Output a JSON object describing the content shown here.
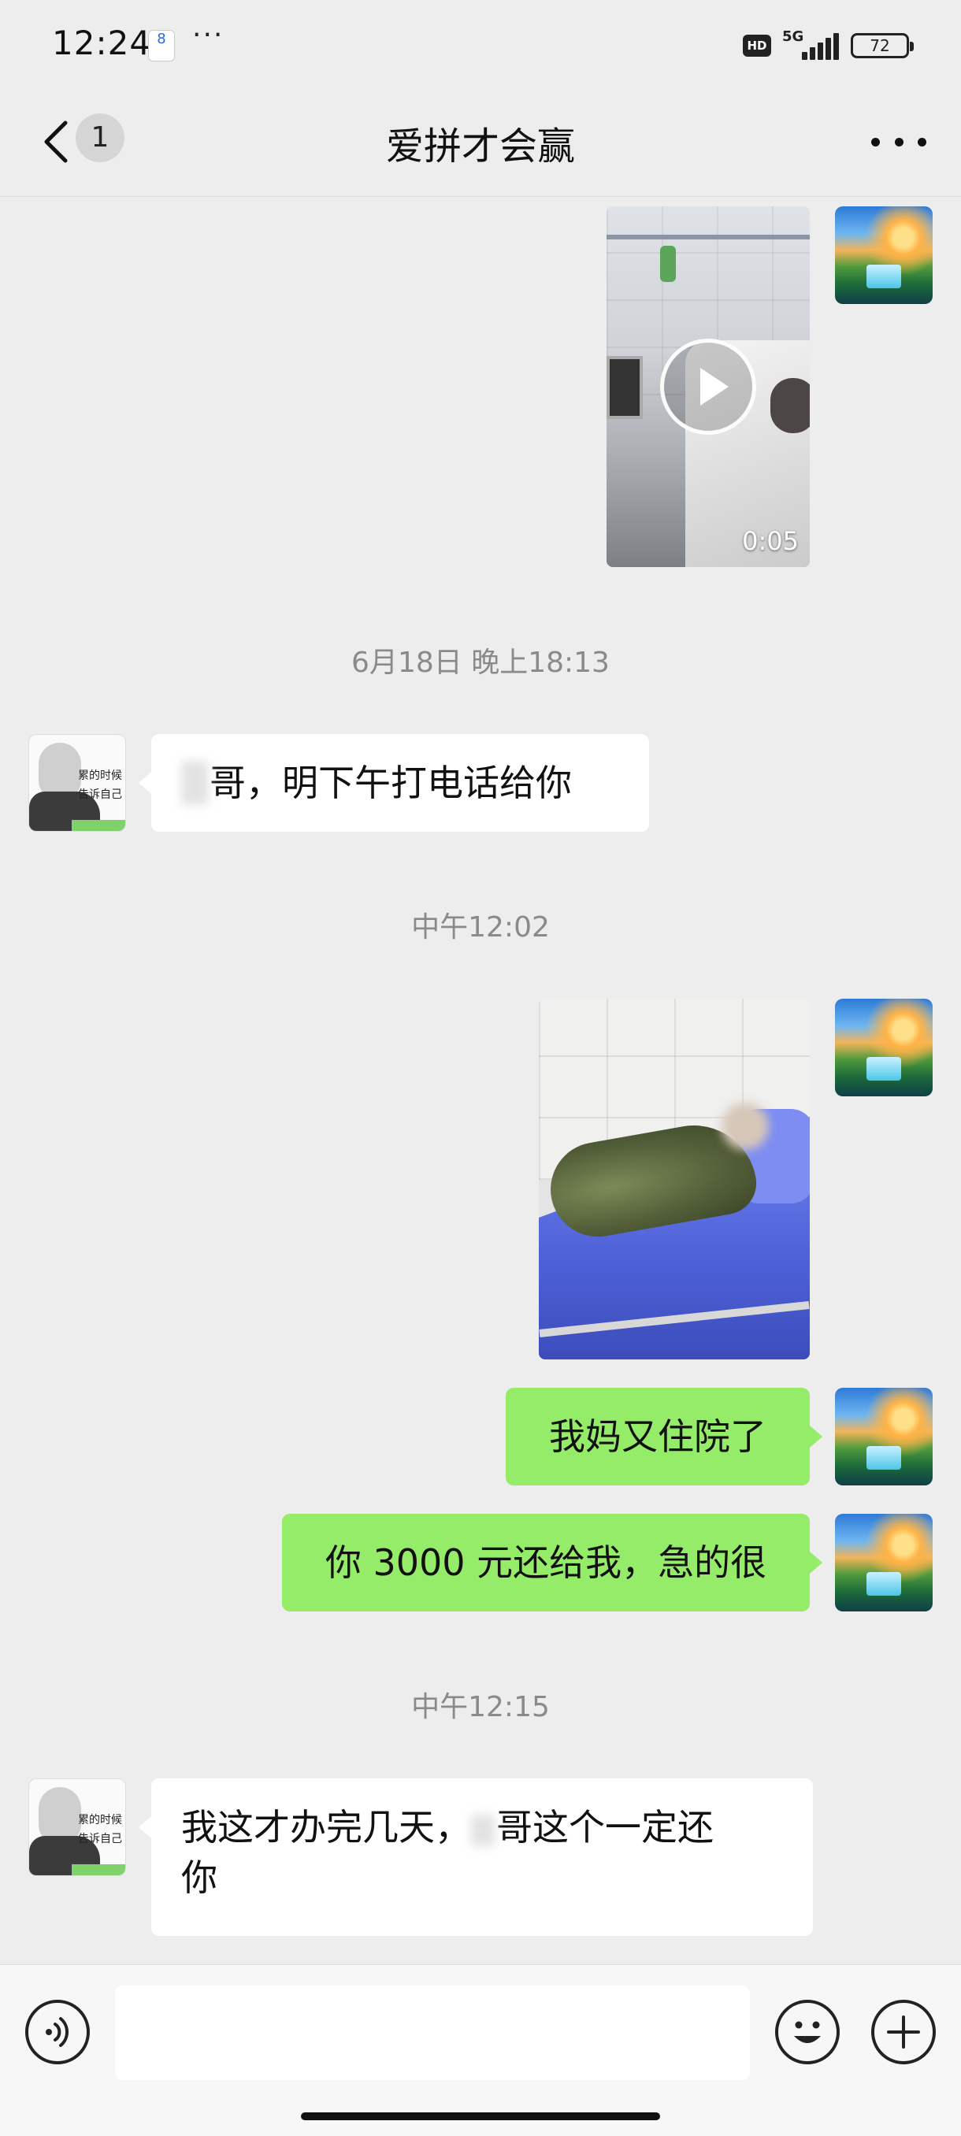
{
  "status_bar": {
    "time": "12:24",
    "notification_badge": "8",
    "more_dots": "···",
    "hd": "HD",
    "network": "5G",
    "battery": "72"
  },
  "header": {
    "back_icon": "chevron-left-icon",
    "unread_count": "1",
    "title": "爱拼才会赢",
    "more_icon": "more-dots-icon"
  },
  "messages": [
    {
      "type": "video",
      "direction": "out",
      "duration": "0:05"
    },
    {
      "type": "timestamp",
      "text": "6月18日 晚上18:13"
    },
    {
      "type": "text",
      "direction": "in",
      "text": "哥，明下午打电话给你"
    },
    {
      "type": "timestamp",
      "text": "中午12:02"
    },
    {
      "type": "image",
      "direction": "out"
    },
    {
      "type": "text",
      "direction": "out",
      "text": "我妈又住院了"
    },
    {
      "type": "text",
      "direction": "out",
      "text": "你 3000 元还给我，急的很"
    },
    {
      "type": "timestamp",
      "text": "中午12:15"
    },
    {
      "type": "text",
      "direction": "in",
      "text_line1_a": "我这才办完几天，",
      "text_line1_b": "哥这个一定还",
      "text_line2": "你"
    }
  ],
  "input_bar": {
    "voice_icon": "voice-icon",
    "input_value": "",
    "emoji_icon": "emoji-icon",
    "plus_icon": "plus-icon"
  },
  "colors": {
    "background": "#ededed",
    "outgoing_bubble": "#95ec69",
    "incoming_bubble": "#ffffff"
  }
}
